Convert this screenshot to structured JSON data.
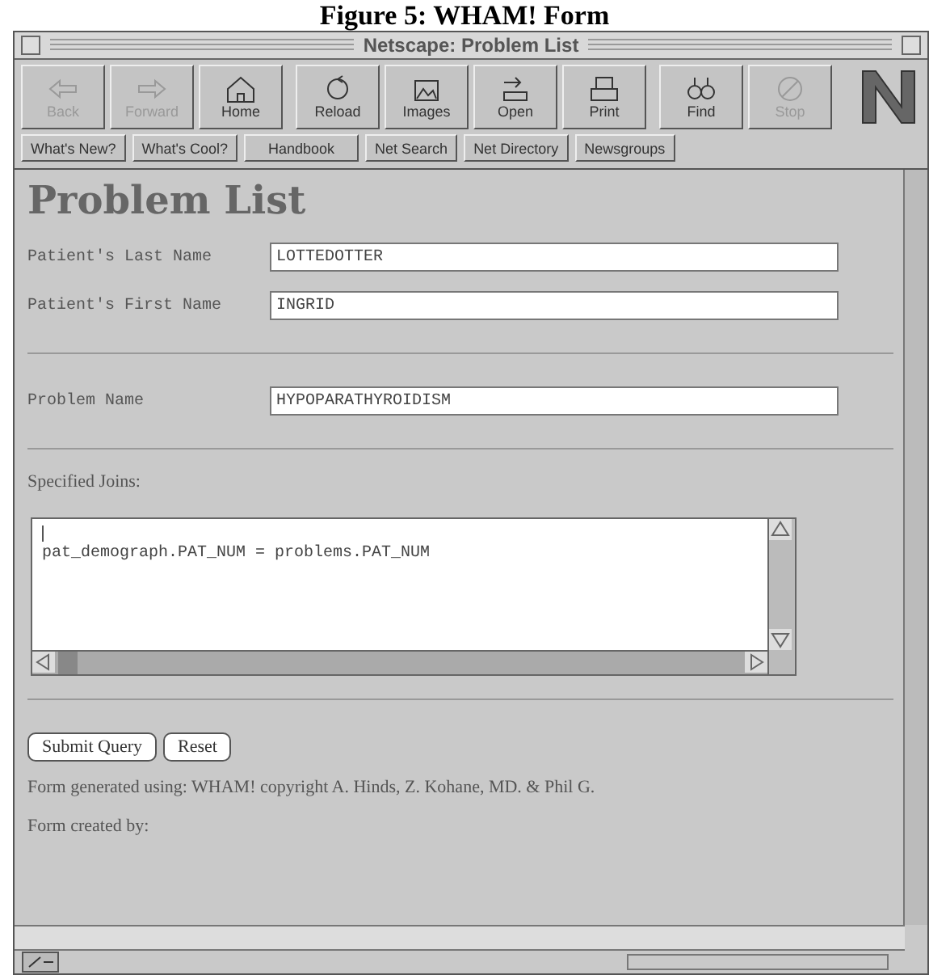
{
  "caption": "Figure 5: WHAM! Form",
  "window": {
    "title": "Netscape: Problem List"
  },
  "toolbar": [
    {
      "label": "Back",
      "kind": "back",
      "disabled": true
    },
    {
      "label": "Forward",
      "kind": "forward",
      "disabled": true
    },
    {
      "label": "Home",
      "kind": "home",
      "disabled": false
    },
    {
      "label": "Reload",
      "kind": "reload",
      "disabled": false
    },
    {
      "label": "Images",
      "kind": "images",
      "disabled": false
    },
    {
      "label": "Open",
      "kind": "open",
      "disabled": false
    },
    {
      "label": "Print",
      "kind": "print",
      "disabled": false
    },
    {
      "label": "Find",
      "kind": "find",
      "disabled": false
    },
    {
      "label": "Stop",
      "kind": "stop",
      "disabled": true
    }
  ],
  "directory_buttons": [
    "What's New?",
    "What's Cool?",
    "Handbook",
    "Net Search",
    "Net Directory",
    "Newsgroups"
  ],
  "page": {
    "heading": "Problem List",
    "patient_fields": [
      {
        "label": "Patient's Last Name",
        "value": "LOTTEDOTTER"
      },
      {
        "label": "Patient's First Name",
        "value": "INGRID"
      }
    ],
    "problem_fields": [
      {
        "label": "Problem Name",
        "value": "HYPOPARATHYROIDISM"
      }
    ],
    "joins_label": "Specified Joins:",
    "joins_value": "pat_demograph.PAT_NUM = problems.PAT_NUM",
    "buttons": [
      "Submit Query",
      "Reset"
    ],
    "footer": [
      "Form generated using: WHAM! copyright A. Hinds, Z. Kohane, MD. & Phil G.",
      "Form created by:"
    ]
  }
}
